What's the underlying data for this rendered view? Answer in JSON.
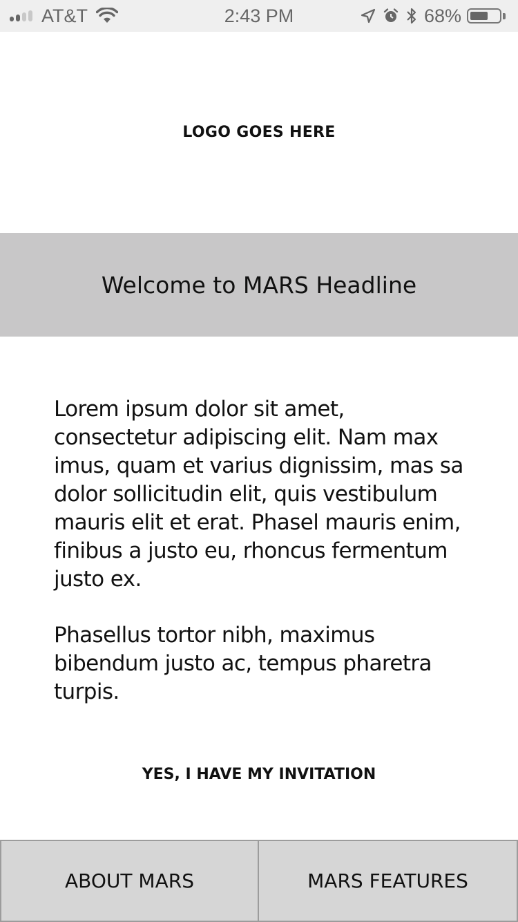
{
  "status_bar": {
    "carrier": "AT&T",
    "time": "2:43 PM",
    "battery_percent": "68%",
    "battery_level": 0.68,
    "icons": [
      "signal-icon",
      "wifi-icon",
      "location-arrow-icon",
      "alarm-icon",
      "bluetooth-icon",
      "battery-icon"
    ]
  },
  "logo": {
    "text": "LOGO GOES HERE"
  },
  "headline": {
    "text": "Welcome to MARS Headline"
  },
  "body": {
    "paragraphs": [
      "Lorem ipsum dolor sit amet, consectetur adipiscing elit. Nam max imus, quam et varius dignissim, mas sa dolor sollicitudin elit, quis vestibulum mauris elit et erat. Phasel mauris enim, finibus a justo eu, rhoncus fermentum justo ex.",
      "Phasellus tortor nibh, maximus bibendum justo ac, tempus pharetra turpis."
    ]
  },
  "invite": {
    "label": "YES, I HAVE MY INVITATION"
  },
  "bottom_nav": {
    "about_label": "ABOUT MARS",
    "features_label": "MARS FEATURES"
  },
  "colors": {
    "status_bar_bg": "#efefef",
    "headline_band_bg": "#c8c7c8",
    "bottom_button_bg": "#d6d6d6",
    "text": "#111111"
  }
}
